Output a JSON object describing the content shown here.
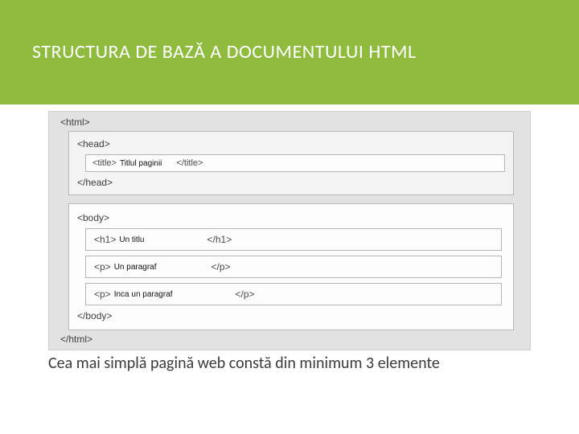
{
  "header": {
    "title": "STRUCTURA DE BAZĂ A DOCUMENTULUI HTML"
  },
  "diagram": {
    "html_open": "<html>",
    "html_close": "</html>",
    "head_open": "<head>",
    "head_close": "</head>",
    "body_open": "<body>",
    "body_close": "</body>",
    "title_row": {
      "open": "<title>",
      "content": "Titlul paginii",
      "close": "</title>"
    },
    "h1_row": {
      "open": "<h1>",
      "content": "Un titlu",
      "close": "</h1>"
    },
    "p1_row": {
      "open": "<p>",
      "content": "Un paragraf",
      "close": "</p>"
    },
    "p2_row": {
      "open": "<p>",
      "content": "Inca un paragraf",
      "close": "</p>"
    }
  },
  "footer": "Cea mai simplă pagină web constă din minimum 3 elemente"
}
